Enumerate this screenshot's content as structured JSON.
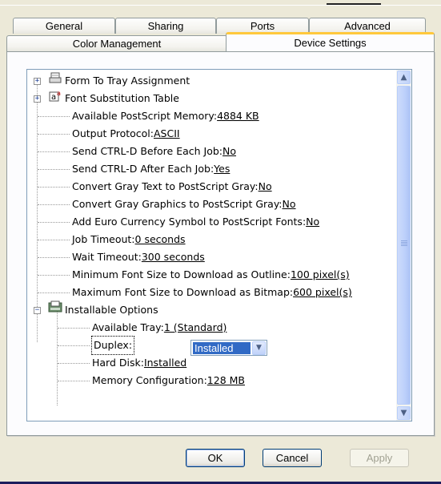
{
  "tabs_row1": [
    {
      "label": "General"
    },
    {
      "label": "Sharing"
    },
    {
      "label": "Ports"
    },
    {
      "label": "Advanced"
    }
  ],
  "tabs_row2": [
    {
      "label": "Color Management"
    },
    {
      "label": "Device Settings",
      "active": true
    }
  ],
  "tree": {
    "groups": [
      {
        "label": "Form To Tray Assignment",
        "icon": "tray-icon",
        "expander": "+"
      },
      {
        "label": "Font Substitution Table",
        "icon": "font-icon",
        "expander": "+"
      }
    ],
    "items": [
      {
        "label": "Available PostScript Memory: ",
        "value": "4884 KB"
      },
      {
        "label": "Output Protocol: ",
        "value": "ASCII"
      },
      {
        "label": "Send CTRL-D Before Each Job: ",
        "value": "No"
      },
      {
        "label": "Send CTRL-D After Each Job: ",
        "value": "Yes"
      },
      {
        "label": "Convert Gray Text to PostScript Gray: ",
        "value": "No"
      },
      {
        "label": "Convert Gray Graphics to PostScript Gray: ",
        "value": "No"
      },
      {
        "label": "Add Euro Currency Symbol to PostScript Fonts: ",
        "value": "No"
      },
      {
        "label": "Job Timeout: ",
        "value": "0 seconds"
      },
      {
        "label": "Wait Timeout: ",
        "value": "300 seconds"
      },
      {
        "label": "Minimum Font Size to Download as Outline: ",
        "value": "100 pixel(s)"
      },
      {
        "label": "Maximum Font Size to Download as Bitmap: ",
        "value": "600 pixel(s)"
      }
    ],
    "installable": {
      "label": "Installable Options",
      "icon": "printer-options-icon",
      "expander": "−"
    },
    "sub_items": [
      {
        "label": "Available Tray: ",
        "value": "1 (Standard)"
      },
      {
        "label": "Duplex:",
        "value": "Installed",
        "editing": true
      },
      {
        "label": "Hard Disk: ",
        "value": "Installed"
      },
      {
        "label": "Memory Configuration: ",
        "value": "128 MB"
      }
    ]
  },
  "scrollbar": {
    "up": "▲",
    "down": "▼"
  },
  "combo": {
    "arrow": "▼"
  },
  "buttons": {
    "ok": "OK",
    "cancel": "Cancel",
    "apply": "Apply"
  }
}
